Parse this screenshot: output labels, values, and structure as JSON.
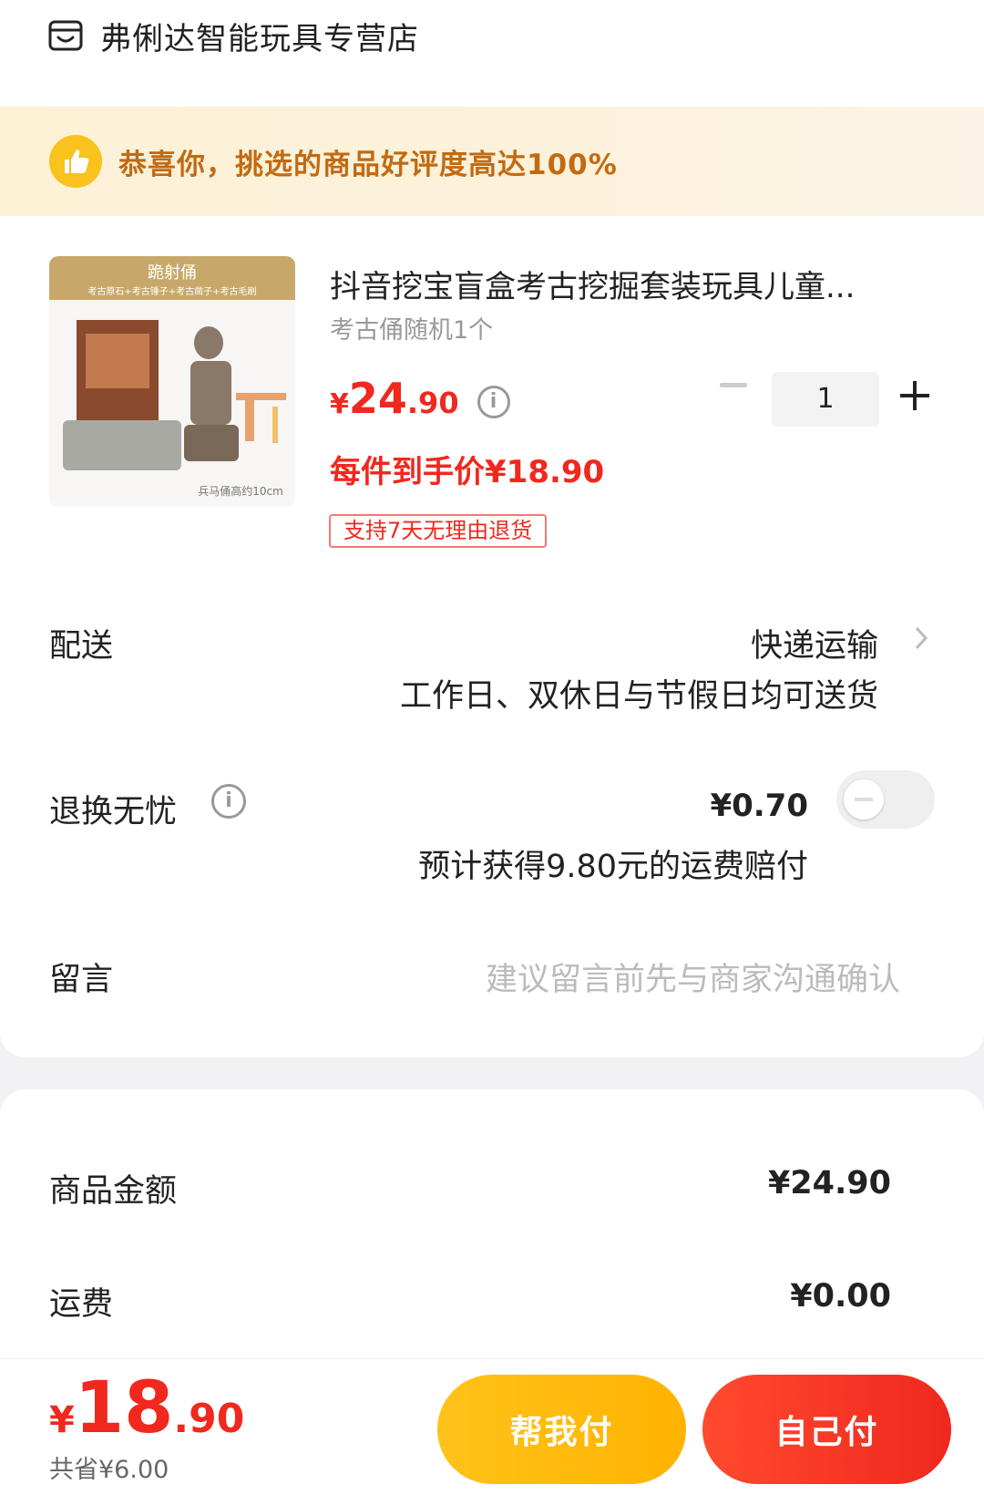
{
  "shop": {
    "name": "弗俐达智能玩具专营店",
    "icon": "store-icon"
  },
  "banner": {
    "text": "恭喜你，挑选的商品好评度高达100%",
    "icon": "thumbs-up-icon"
  },
  "product": {
    "title": "抖音挖宝盲盒考古挖掘套装玩具儿童...",
    "sku": "考古俑随机1个",
    "price_symbol": "¥",
    "price_int": "24",
    "price_dec": ".90",
    "quantity": "1",
    "deal_price": "每件到手价¥18.90",
    "return_badge": "支持7天无理由退货",
    "image_caption_top": "跪射俑",
    "image_caption_sub": "考古原石+考古锤子+考古凿子+考古毛刷",
    "image_caption_bottom": "兵马俑高约10cm"
  },
  "shipping": {
    "label": "配送",
    "value": "快递运输",
    "note": "工作日、双休日与节假日均可送货"
  },
  "insurance": {
    "label": "退换无忧",
    "price": "¥0.70",
    "note": "预计获得9.80元的运费赔付",
    "enabled": false
  },
  "message": {
    "label": "留言",
    "placeholder": "建议留言前先与商家沟通确认"
  },
  "summary": {
    "goods_label": "商品金额",
    "goods_value": "¥24.90",
    "freight_label": "运费",
    "freight_value": "¥0.00"
  },
  "footer": {
    "total_symbol": "¥",
    "total_int": "18",
    "total_dec": ".90",
    "saved": "共省¥6.00",
    "help_pay_label": "帮我付",
    "self_pay_label": "自己付"
  },
  "colors": {
    "accent_red": "#f0281e",
    "accent_yellow": "#ffc21a",
    "banner_text": "#c26a12"
  }
}
